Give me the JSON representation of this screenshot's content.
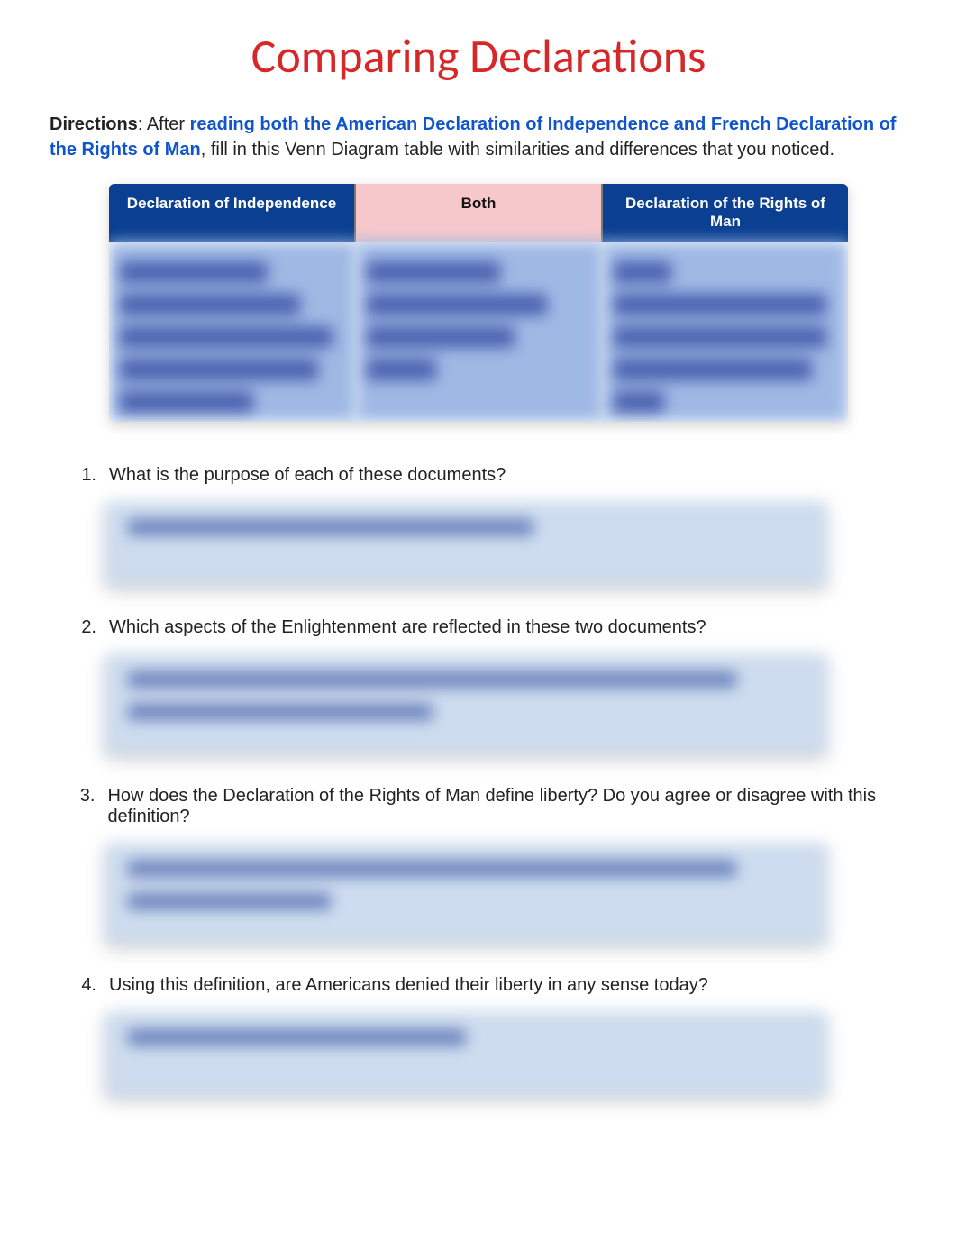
{
  "title": "Comparing Declarations",
  "directions": {
    "label": "Directions",
    "after": ": After ",
    "link": "reading both the American Declaration of Independence and French Declaration of the Rights of Man",
    "rest": ", fill in this Venn Diagram table with similarities and differences that you noticed."
  },
  "venn": {
    "col1_header": "Declaration of Independence",
    "col2_header": "Both",
    "col3_header": "Declaration of the Rights of Man"
  },
  "questions": {
    "q1_num": "1.",
    "q1_text": "What is the purpose of each of these documents?",
    "q2_num": "2.",
    "q2_text": "Which aspects of the Enlightenment are reflected in these two documents?",
    "q3_num": "3.",
    "q3_text": "How does the Declaration of the Rights of Man define liberty? Do you agree or disagree with this definition?",
    "q4_num": "4.",
    "q4_text": "Using this definition, are Americans denied their liberty in any sense today?"
  }
}
